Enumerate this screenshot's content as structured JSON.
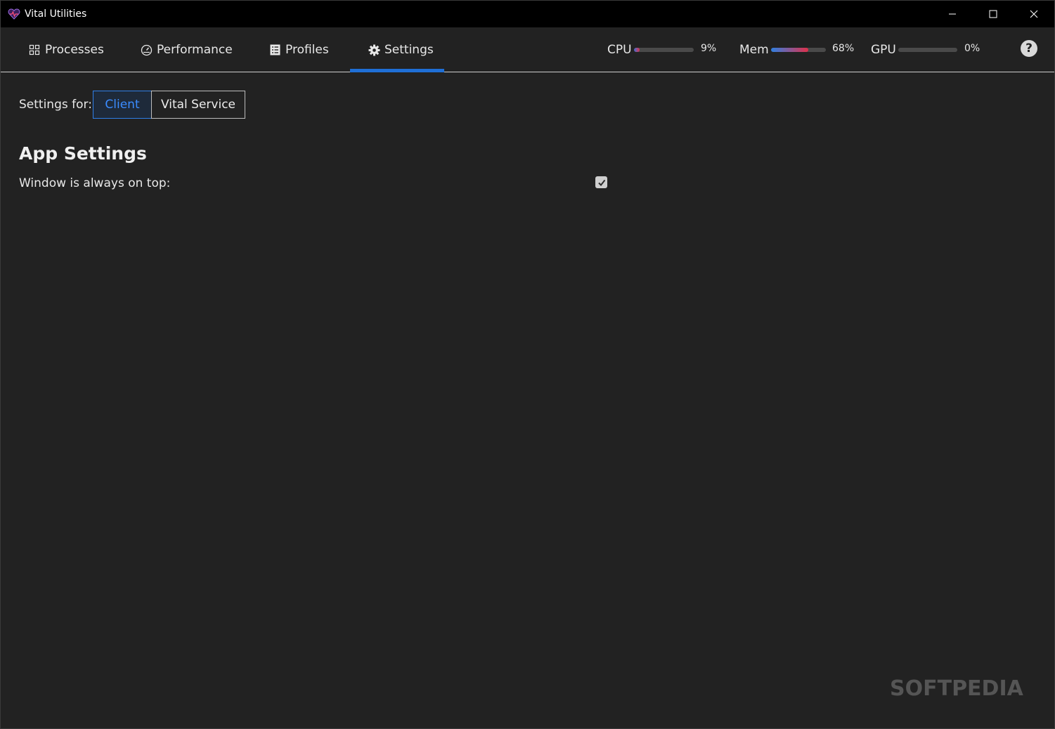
{
  "window": {
    "title": "Vital Utilities",
    "controls": {
      "minimize_icon": "minimize-icon",
      "maximize_icon": "maximize-icon",
      "close_icon": "close-icon"
    }
  },
  "nav": {
    "tabs": [
      {
        "label": "Processes",
        "icon": "grid-icon"
      },
      {
        "label": "Performance",
        "icon": "gauge-icon"
      },
      {
        "label": "Profiles",
        "icon": "list-icon"
      },
      {
        "label": "Settings",
        "icon": "gear-icon",
        "active": true
      }
    ],
    "accent_color": "#1f6fd6"
  },
  "meters": {
    "cpu": {
      "label": "CPU",
      "value": "9%",
      "percent": 9
    },
    "mem": {
      "label": "Mem",
      "value": "68%",
      "percent": 68
    },
    "gpu": {
      "label": "GPU",
      "value": "0%",
      "percent": 0
    }
  },
  "help": {
    "label": "?"
  },
  "settings": {
    "for_label": "Settings for:",
    "targets": [
      {
        "label": "Client",
        "selected": true
      },
      {
        "label": "Vital Service",
        "selected": false
      }
    ],
    "section_title": "App Settings",
    "options": [
      {
        "label": "Window is always on top:",
        "checked": true
      }
    ]
  },
  "watermark": "SOFTPEDIA"
}
